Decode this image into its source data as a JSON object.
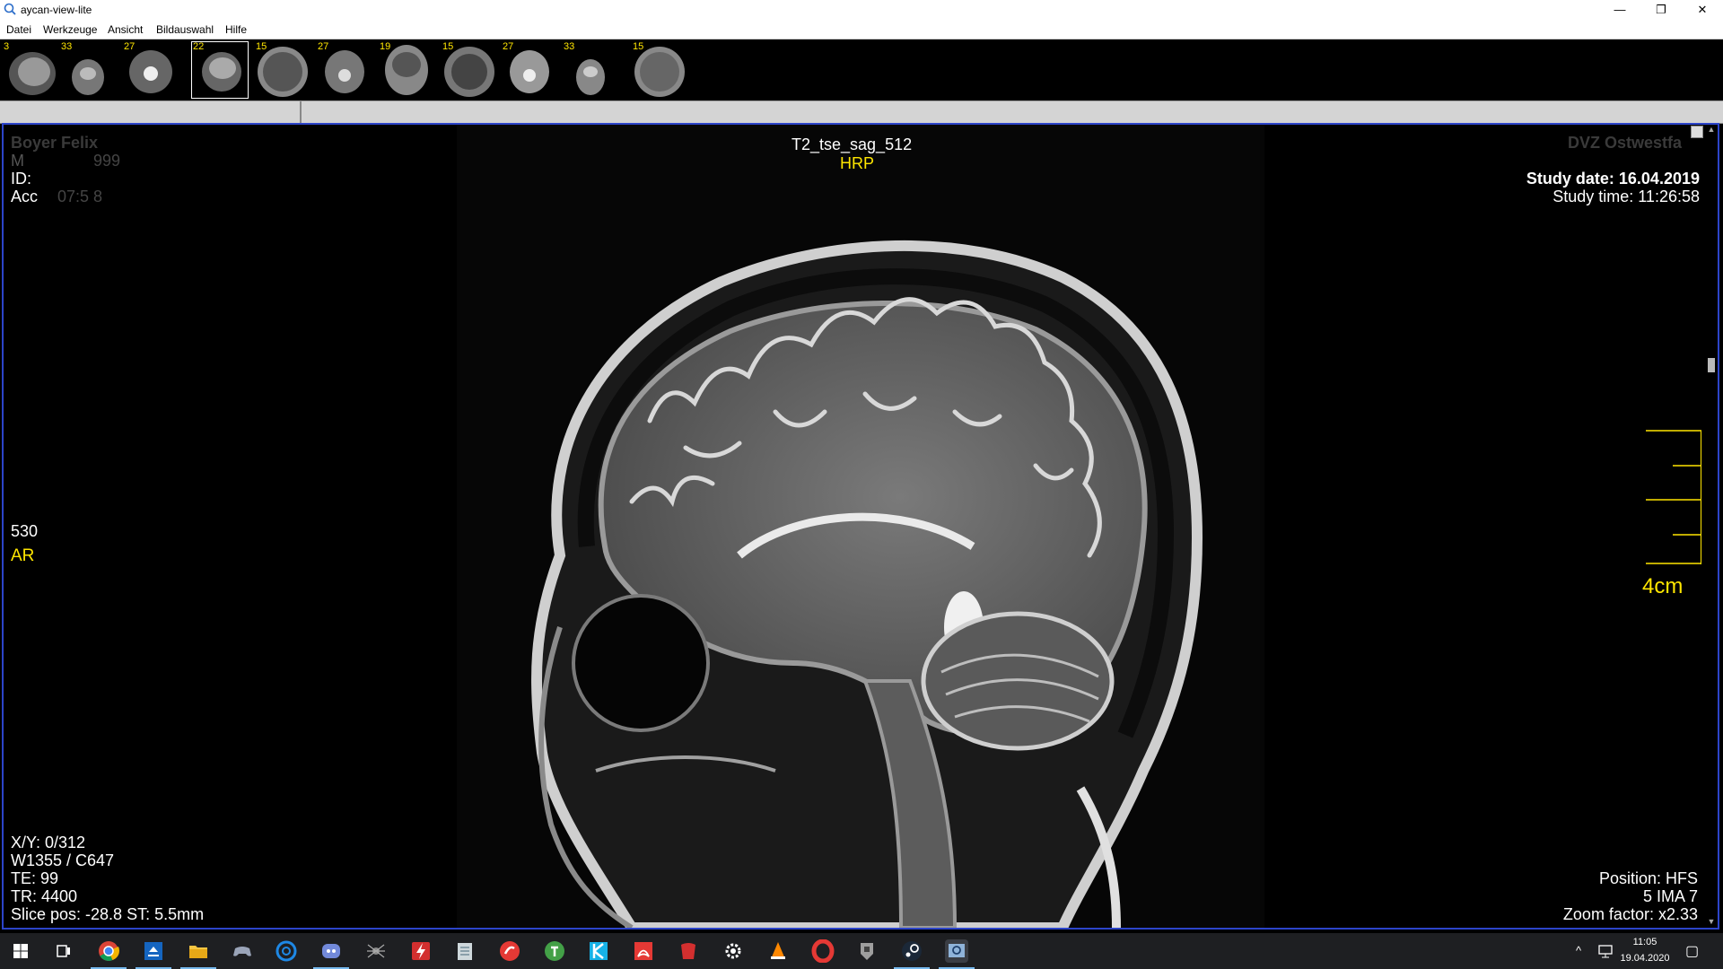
{
  "window": {
    "title": "aycan-view-lite",
    "minimize": "—",
    "restore": "❐",
    "close": "✕"
  },
  "menu": [
    "Datei",
    "Werkzeuge",
    "Ansicht",
    "Bildauswahl",
    "Hilfe"
  ],
  "thumbnails": [
    {
      "count": "3"
    },
    {
      "count": "33"
    },
    {
      "count": "27"
    },
    {
      "count": "22",
      "selected": true
    },
    {
      "count": "15"
    },
    {
      "count": "27"
    },
    {
      "count": "19"
    },
    {
      "count": "15"
    },
    {
      "count": "27"
    },
    {
      "count": "33"
    },
    {
      "count": "15"
    }
  ],
  "overlay": {
    "series": "T2_tse_sag_512",
    "orientation_top": "HRP",
    "patient_name": "Boyer Felix",
    "patient_line2_prefix": "M",
    "patient_line2_suffix": "999",
    "id_label": "ID:",
    "acc_label": "Acc",
    "acc_suffix": "07:5 8",
    "institution": "DVZ Ostwestfa",
    "study_date": "Study date: 16.04.2019",
    "study_time": "Study time: 11:26:58",
    "left_number": "530",
    "orientation_left": "AR",
    "scale_label": "4cm",
    "xy": "X/Y: 0/312",
    "window_level": "W1355 / C647",
    "te": "TE: 99",
    "tr": "TR: 4400",
    "slice": "Slice pos: -28.8  ST: 5.5mm",
    "position": "Position: HFS",
    "image_index": "5 IMA 7",
    "zoom": "Zoom factor: x2.33"
  },
  "taskbar": {
    "icons": [
      "windows-start",
      "task-view",
      "chrome",
      "download-manager",
      "file-explorer",
      "gamepad",
      "uplay",
      "discord",
      "spider",
      "lightning",
      "notepad",
      "shield-app",
      "torrent",
      "kodi",
      "acrobat",
      "red-app",
      "settings",
      "vlc",
      "opera",
      "tank-game",
      "steam",
      "aycan-view"
    ],
    "time": "11:05",
    "date": "19.04.2020",
    "tray_chevron": "^",
    "notification": "▢"
  },
  "colors": {
    "accent_yellow": "#ffe600",
    "viewer_border": "#2c44c9",
    "taskbar": "#1e1f22"
  }
}
